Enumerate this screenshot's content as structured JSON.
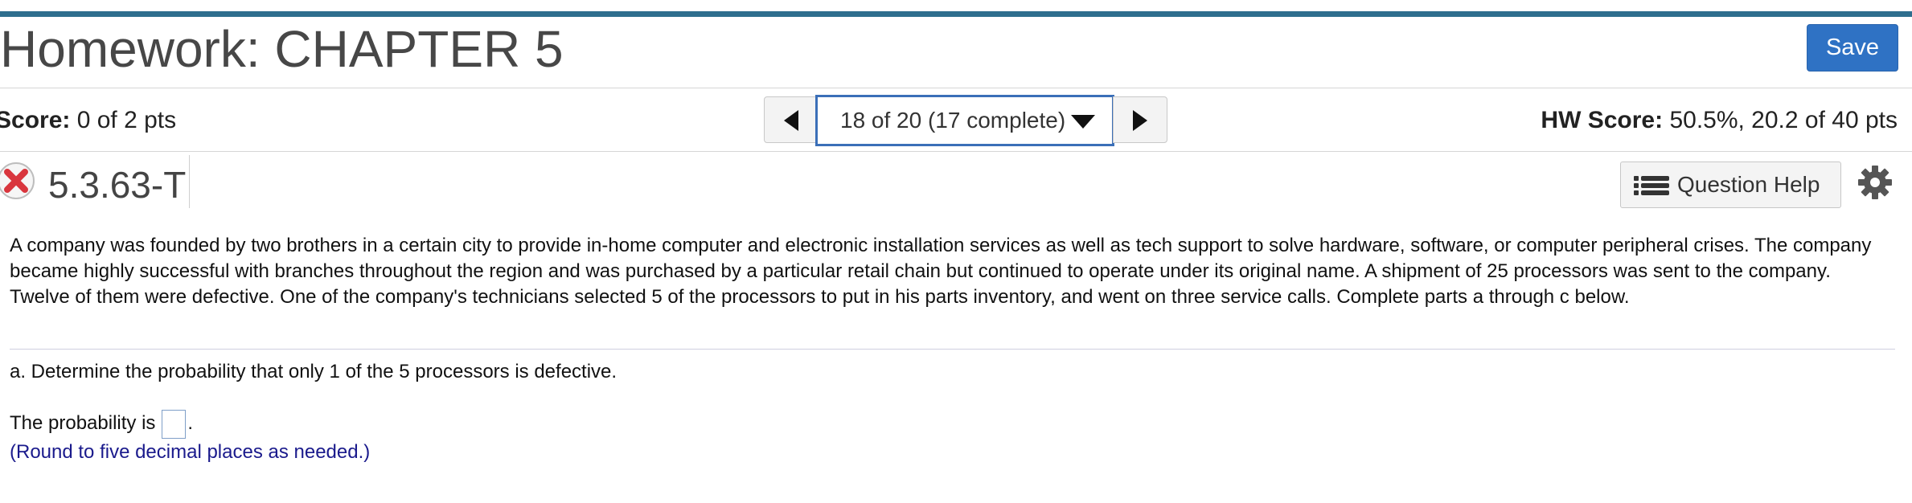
{
  "header": {
    "title": "Homework: CHAPTER 5",
    "save_label": "Save"
  },
  "score_bar": {
    "score_label": "Score:",
    "score_value": "0 of 2 pts",
    "nav_label": "18 of 20 (17 complete)",
    "hw_score_label": "HW Score:",
    "hw_score_value": "50.5%, 20.2 of 40 pts"
  },
  "question": {
    "id": "5.3.63-T",
    "help_label": "Question Help",
    "status_icon": "x-icon",
    "settings_icon": "gear-icon"
  },
  "problem": {
    "text": "A company was founded by two brothers in a certain city to provide in-home computer and electronic installation services as well as tech support to solve hardware, software, or computer peripheral crises. The company became highly successful with branches throughout the region and was purchased by a particular retail chain but continued to operate under its original name. A shipment of 25 processors was sent to the company. Twelve of them were defective. One of the company's technicians selected 5 of the processors to put in his parts inventory, and went on three service calls. Complete parts a through c below.",
    "part_a": "a. Determine the probability that only 1 of the 5 processors is defective.",
    "answer_prefix": "The probability is",
    "answer_suffix": ".",
    "answer_value": "",
    "hint": "(Round to five decimal places as needed.)"
  },
  "colors": {
    "accent": "#2f72c4",
    "topbar": "#2e6e8e",
    "error": "#d9363e",
    "hint": "#1a1a8c"
  }
}
